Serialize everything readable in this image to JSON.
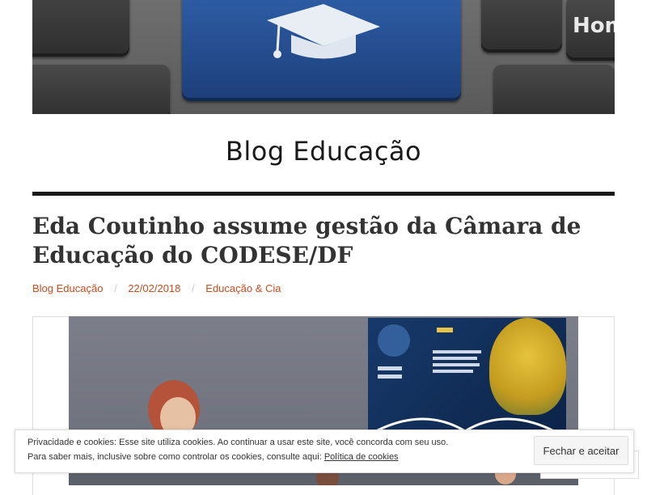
{
  "header": {
    "home_key_label": "Hom",
    "site_title": "Blog Educação"
  },
  "post": {
    "title": "Eda Coutinho assume gestão da Câmara de Educação do CODESE/DF",
    "meta": {
      "author": "Blog Educação",
      "date": "22/02/2018",
      "category": "Educação & Cia",
      "separator": "/"
    }
  },
  "cookie_banner": {
    "text_line1": "Privacidade e cookies: Esse site utiliza cookies. Ao continuar a usar este site, você concorda com seu uso.",
    "text_line2_prefix": "Para saber mais, inclusive sobre como controlar os cookies, consulte aqui: ",
    "policy_link": "Política de cookies",
    "accept_button": "Fechar e aceitar"
  },
  "colors": {
    "accent": "#c84b1e",
    "title_text": "#333333",
    "rule": "#1a1a1a"
  }
}
